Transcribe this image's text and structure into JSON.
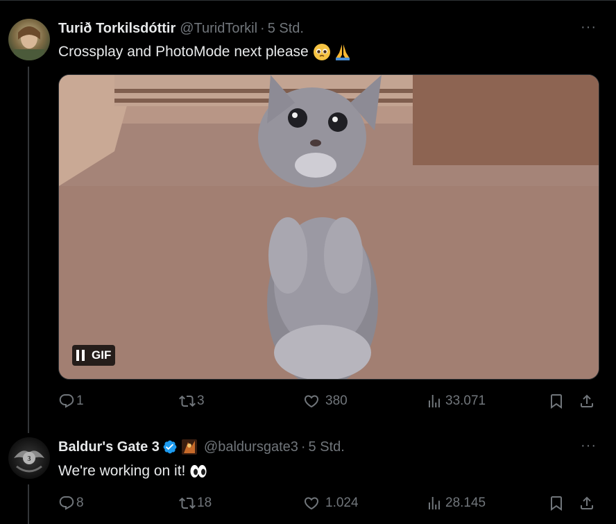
{
  "tweets": [
    {
      "display_name": "Turið Torkilsdóttir",
      "handle": "@TuridTorkil",
      "separator": "·",
      "time": "5 Std.",
      "text": "Crossplay and PhotoMode next please",
      "emojis": [
        "pleading-face",
        "folded-hands"
      ],
      "media": {
        "type": "gif",
        "label": "GIF",
        "subject": "grey tabby cat standing on hind legs"
      },
      "more": "···",
      "actions": {
        "replies": "1",
        "reposts": "3",
        "likes": "380",
        "views": "33.071"
      }
    },
    {
      "display_name": "Baldur's Gate 3",
      "verified": true,
      "handle": "@baldursgate3",
      "separator": "·",
      "time": "5 Std.",
      "text": "We're working on it!",
      "emojis": [
        "eyes"
      ],
      "more": "···",
      "actions": {
        "replies": "8",
        "reposts": "18",
        "likes": "1.024",
        "views": "28.145"
      }
    }
  ],
  "colors": {
    "background": "#000000",
    "text_primary": "#e7e9ea",
    "text_secondary": "#71767b",
    "verified": "#1d9bf0",
    "divider": "#2f3336"
  }
}
